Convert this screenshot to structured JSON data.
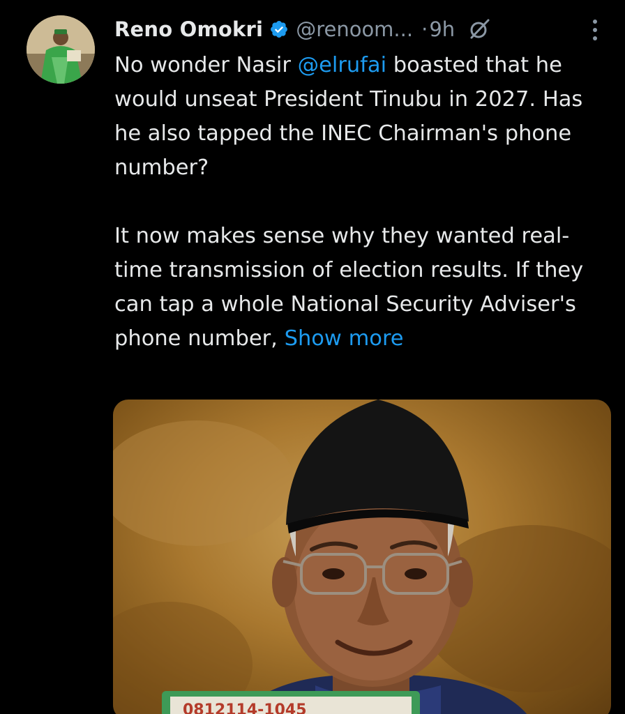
{
  "author": {
    "name": "Reno Omokri",
    "handle": "@renoom...",
    "separator": "·",
    "time": "9h"
  },
  "tweet": {
    "paragraph1_start": "No wonder Nasir ",
    "mention": "@elrufai",
    "paragraph1_end": " boasted that he would unseat President Tinubu in 2027. Has he also tapped the  INEC Chairman's phone number?",
    "paragraph2": "It now makes sense why they wanted real-time transmission of election results. If they can tap a whole National Security Adviser's phone number, ",
    "show_more": "Show more"
  },
  "media": {
    "card_text": "0812114-1045"
  },
  "icons": {
    "verified": "verified-badge-icon",
    "grok": "grok-icon",
    "more": "more-vertical-icon"
  },
  "colors": {
    "background": "#000000",
    "text": "#e7e9ea",
    "secondary": "#8b98a5",
    "link": "#1d9bf0"
  }
}
